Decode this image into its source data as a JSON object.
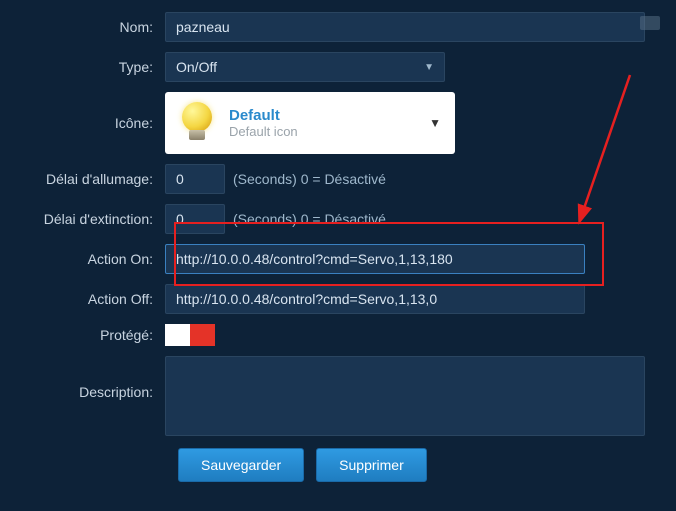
{
  "labels": {
    "nom": "Nom:",
    "type": "Type:",
    "icone": "Icône:",
    "delai_on": "Délai d'allumage:",
    "delai_off": "Délai d'extinction:",
    "action_on": "Action On:",
    "action_off": "Action Off:",
    "protege": "Protégé:",
    "description": "Description:"
  },
  "values": {
    "nom": "pazneau",
    "type": "On/Off",
    "delai_on": "0",
    "delai_off": "0",
    "action_on": "http://10.0.0.48/control?cmd=Servo,1,13,180",
    "action_off": "http://10.0.0.48/control?cmd=Servo,1,13,0",
    "description": ""
  },
  "hints": {
    "seconds": "(Seconds) 0 = Désactivé"
  },
  "icon_picker": {
    "title": "Default",
    "subtitle": "Default icon"
  },
  "buttons": {
    "save": "Sauvegarder",
    "delete": "Supprimer"
  }
}
